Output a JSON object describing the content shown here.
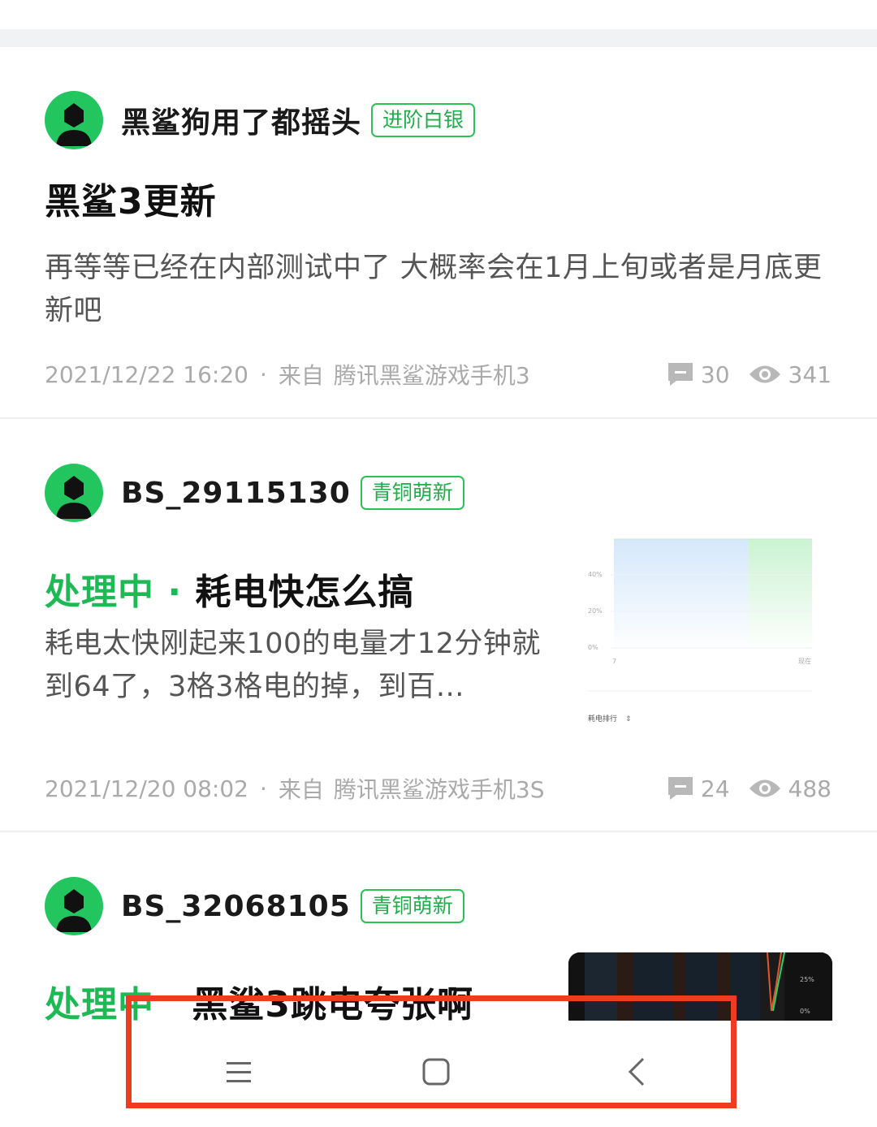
{
  "posts": [
    {
      "author": "黑鲨狗用了都摇头",
      "badge": "进阶白银",
      "title": "黑鲨3更新",
      "body": "再等等已经在内部测试中了 大概率会在1月上旬或者是月底更新吧",
      "time": "2021/12/22 16:20",
      "source_prefix": "来自",
      "source": "腾讯黑鲨游戏手机3",
      "comments": "30",
      "views": "341"
    },
    {
      "author": "BS_29115130",
      "badge": "青铜萌新",
      "status": "处理中",
      "status_dot": "·",
      "title": "耗电快怎么搞",
      "body": "耗电太快刚起来100的电量才12分钟就到64了，3格3格电的掉，到百…",
      "time": "2021/12/20 08:02",
      "source_prefix": "来自",
      "source": "腾讯黑鲨游戏手机3S",
      "comments": "24",
      "views": "488",
      "thumbnail": {
        "y_ticks": [
          "40%",
          "20%",
          "0%"
        ],
        "x_start": "7",
        "x_end": "现在",
        "footer_label": "耗电排行"
      }
    },
    {
      "author": "BS_32068105",
      "badge": "青铜萌新",
      "status": "处理中",
      "title": "黑鲨3跳电夸张啊",
      "thumbnail": {
        "y_ticks": [
          "25%",
          "0%"
        ]
      }
    }
  ],
  "nav": {
    "menu_icon": "menu-icon",
    "home_icon": "home-square-icon",
    "back_icon": "back-chevron-icon"
  },
  "colors": {
    "accent_green": "#1db954",
    "avatar_green": "#22c55e",
    "highlight_red": "#ee3b22",
    "meta_gray": "#aaaaaa"
  }
}
